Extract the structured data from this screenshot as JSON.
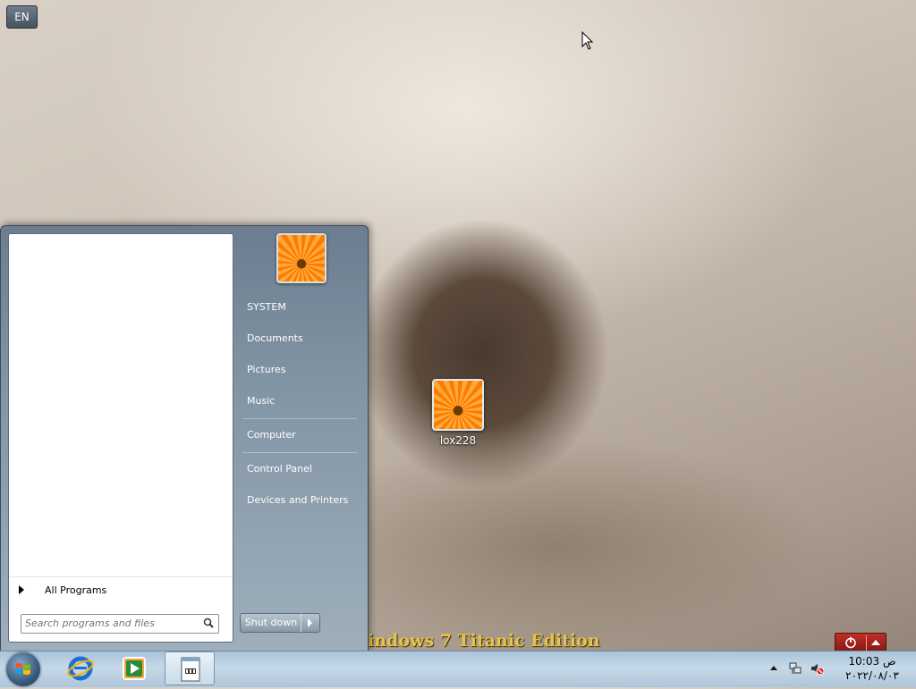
{
  "language_indicator": "EN",
  "desktop": {
    "icons": [
      {
        "label": "lox228",
        "icon": "flower-user-icon"
      }
    ],
    "watermark": "indows 7 Titanic Edition"
  },
  "start_menu": {
    "all_programs_label": "All Programs",
    "search": {
      "placeholder": "Search programs and files",
      "value": ""
    },
    "user_picture": "flower-user-icon",
    "right_links": [
      {
        "label": "SYSTEM"
      },
      {
        "label": "Documents"
      },
      {
        "label": "Pictures"
      },
      {
        "label": "Music"
      },
      {
        "label": "Computer"
      },
      {
        "label": "Control Panel"
      },
      {
        "label": "Devices and Printers"
      }
    ],
    "shutdown_label": "Shut down"
  },
  "taskbar": {
    "pinned": [
      {
        "name": "internet-explorer-icon"
      },
      {
        "name": "media-player-icon"
      },
      {
        "name": "notepad-icon",
        "active": true
      }
    ],
    "tray_icons": [
      "network-icon",
      "volume-muted-icon"
    ],
    "clock": {
      "time": "10:03 ص",
      "date": "٢٠٢٢/٠٨/٠٣"
    }
  },
  "colors": {
    "taskbar": "#b7cde0",
    "start_menu_right": "#8396a6",
    "watermark": "#e6c34a",
    "tools_button": "#a8221c"
  }
}
